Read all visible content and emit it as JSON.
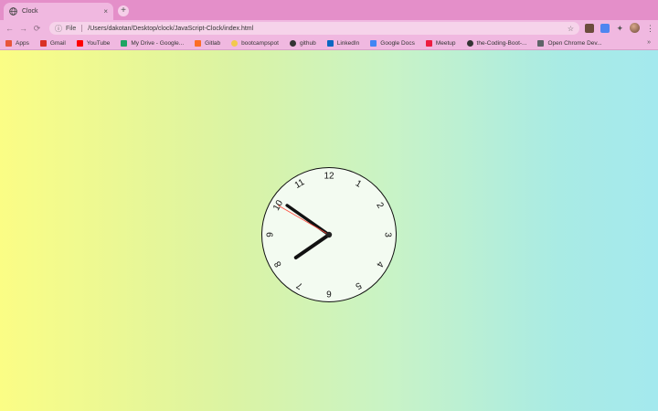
{
  "tab": {
    "title": "Clock",
    "close_glyph": "×",
    "new_tab_glyph": "+"
  },
  "toolbar": {
    "back_glyph": "←",
    "forward_glyph": "→",
    "reload_glyph": "⟳",
    "info_glyph": "ⓘ",
    "scheme_label": "File",
    "url": "/Users/dakotan/Desktop/clock/JavaScript-Clock/index.html",
    "star_glyph": "☆",
    "puzzle_glyph": "✦",
    "menu_glyph": "⋮"
  },
  "bookmarks": [
    {
      "label": "Apps",
      "icon": "apps-grid-icon",
      "color": "#e8553a"
    },
    {
      "label": "Gmail",
      "icon": "gmail-icon",
      "color": "#d93025"
    },
    {
      "label": "YouTube",
      "icon": "youtube-icon",
      "color": "#ff0000"
    },
    {
      "label": "My Drive - Google...",
      "icon": "google-drive-icon",
      "color": "#1fa463"
    },
    {
      "label": "Gitlab",
      "icon": "gitlab-icon",
      "color": "#fc6d26"
    },
    {
      "label": "bootcampspot",
      "icon": "bootcampspot-icon",
      "color": "#f2c94c"
    },
    {
      "label": "github",
      "icon": "github-icon",
      "color": "#333333"
    },
    {
      "label": "LinkedIn",
      "icon": "linkedin-icon",
      "color": "#0a66c2"
    },
    {
      "label": "Google Docs",
      "icon": "google-docs-icon",
      "color": "#4285f4"
    },
    {
      "label": "Meetup",
      "icon": "meetup-icon",
      "color": "#ed1c40"
    },
    {
      "label": "the-Coding-Boot-...",
      "icon": "github-icon",
      "color": "#333333"
    },
    {
      "label": "Open Chrome Dev...",
      "icon": "code-icon",
      "color": "#5f6368"
    }
  ],
  "bookmarks_overflow_glyph": "»",
  "clock": {
    "numerals": [
      "12",
      "1",
      "2",
      "3",
      "4",
      "5",
      "6",
      "7",
      "8",
      "9",
      "10",
      "11"
    ],
    "time": {
      "hours": 7,
      "minutes": 50,
      "seconds": 50
    },
    "face_color": "#f3fbf1",
    "hand_color": "#111111",
    "second_hand_color": "#ff4a3d"
  }
}
